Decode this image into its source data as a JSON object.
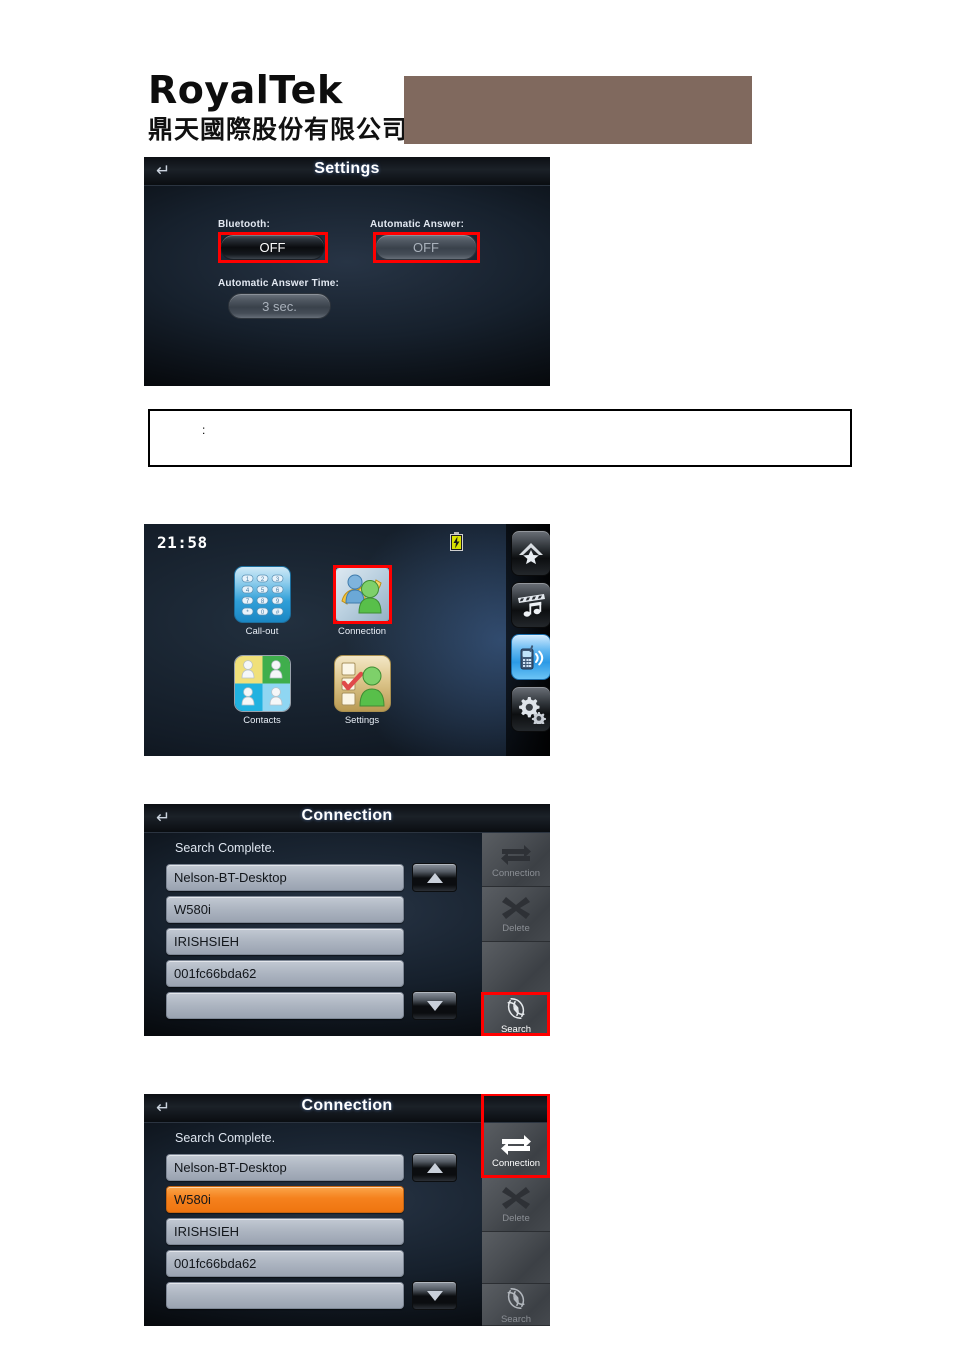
{
  "header": {
    "logo_wordmark": "RoyalTek",
    "logo_cjk": "鼎天國際股份有限公司",
    "banner_color": "#80695e"
  },
  "note_box": {
    "text": ":"
  },
  "screens": {
    "settings": {
      "title": "Settings",
      "back_icon": "back-arrow-icon",
      "fields": [
        {
          "label": "Bluetooth:",
          "value": "OFF",
          "state": "on",
          "highlighted": true
        },
        {
          "label": "Automatic Answer:",
          "value": "OFF",
          "state": "off",
          "highlighted": true
        },
        {
          "label": "Automatic Answer Time:",
          "value": "3 sec.",
          "state": "off",
          "highlighted": false
        }
      ]
    },
    "main_menu": {
      "clock": "21:58",
      "battery_icon": "battery-charging-icon",
      "apps": [
        {
          "label": "Call-out",
          "icon": "keypad-icon",
          "highlighted": false
        },
        {
          "label": "Connection",
          "icon": "two-people-exchange-icon",
          "highlighted": true
        },
        {
          "label": "Contacts",
          "icon": "contacts-quad-icon",
          "highlighted": false
        },
        {
          "label": "Settings",
          "icon": "checklist-person-icon",
          "highlighted": false
        }
      ],
      "keypad_keys": [
        "1",
        "2",
        "3",
        "4",
        "5",
        "6",
        "7",
        "8",
        "9",
        "*",
        "0",
        "#"
      ],
      "sidebar": [
        {
          "icon": "home-star-icon",
          "active": false
        },
        {
          "icon": "media-clapper-music-icon",
          "active": false
        },
        {
          "icon": "phone-signal-icon",
          "active": true
        },
        {
          "icon": "gears-settings-icon",
          "active": false
        }
      ]
    },
    "connection_search": {
      "title": "Connection",
      "status": "Search Complete.",
      "devices": [
        {
          "name": "Nelson-BT-Desktop",
          "selected": false
        },
        {
          "name": "W580i",
          "selected": false
        },
        {
          "name": "IRISHSIEH",
          "selected": false
        },
        {
          "name": "001fc66bda62",
          "selected": false
        },
        {
          "name": "",
          "selected": false
        }
      ],
      "scroll_up": "scroll-up-icon",
      "scroll_down": "scroll-down-icon",
      "sidebar": [
        {
          "label": "Connection",
          "icon": "exchange-arrows-icon",
          "enabled": false,
          "highlighted": false
        },
        {
          "label": "Delete",
          "icon": "x-close-icon",
          "enabled": false,
          "highlighted": false
        },
        {
          "label": "",
          "icon": "",
          "enabled": false,
          "highlighted": false
        },
        {
          "label": "Search",
          "icon": "radar-search-icon",
          "enabled": true,
          "highlighted": true
        }
      ]
    },
    "connection_selected": {
      "title": "Connection",
      "status": "Search Complete.",
      "devices": [
        {
          "name": "Nelson-BT-Desktop",
          "selected": false
        },
        {
          "name": "W580i",
          "selected": true
        },
        {
          "name": "IRISHSIEH",
          "selected": false
        },
        {
          "name": "001fc66bda62",
          "selected": false
        },
        {
          "name": "",
          "selected": false
        }
      ],
      "scroll_up": "scroll-up-icon",
      "scroll_down": "scroll-down-icon",
      "sidebar": [
        {
          "label": "Connection",
          "icon": "exchange-arrows-icon",
          "enabled": true,
          "highlighted": true
        },
        {
          "label": "Delete",
          "icon": "x-close-icon",
          "enabled": false,
          "highlighted": false
        },
        {
          "label": "",
          "icon": "",
          "enabled": false,
          "highlighted": false
        },
        {
          "label": "Search",
          "icon": "radar-search-icon",
          "enabled": false,
          "highlighted": false
        }
      ]
    }
  },
  "colors": {
    "selected_row": "#f5811d",
    "highlight_ring": "#ff0000",
    "accent_blue": "#2b9ae6"
  }
}
